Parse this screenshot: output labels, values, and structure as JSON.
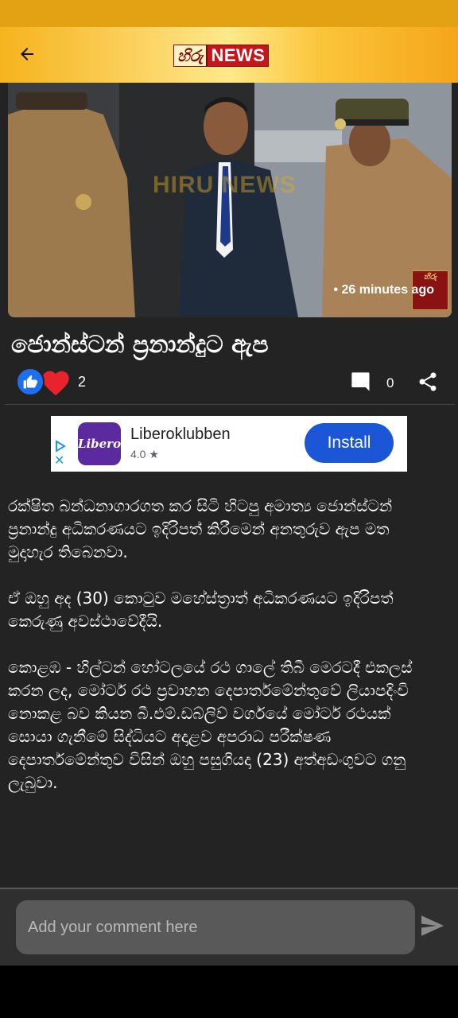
{
  "header": {
    "logo_hiru": "හිරු",
    "logo_news": "NEWS",
    "back_icon": "arrow-left-icon"
  },
  "hero": {
    "watermark": "HIRU NEWS",
    "timestamp": "• 26 minutes ago",
    "logo_text": "හිරු"
  },
  "article": {
    "title": "ජොන්ස්ටන් ප්‍රනාන්දුට ඇප",
    "reaction_count": "2",
    "comment_count": "0",
    "paragraphs": [
      "රක්ෂිත බන්ධනාගාරගත කර සිටි හිටපු අමාත්‍ය ජොන්ස්ටන් ප්‍රනාන්දු අධිකරණයට ඉදිරිපත් කිරීමෙන් අනතුරුව ඇප මත මුදාහැර තිබෙනවා.",
      "ඒ ඔහු අද (30) කොටුව මහේස්ත්‍රාත් අධිකරණයට ඉදිරිපත් කෙරුණු අවස්ථාවේදීයි.",
      "කොළඹ - හිල්ටන් හෝටලයේ රථ ගාලේ තිබී මෙරටදී එකලස් කරන ලද, මෝටර් රථ ප්‍රවාහන දෙපාර්තමේන්තුවේ ලියාපදිංචි නොකළ බව කියන බී.එම්.ඩබ්ලිව් වර්ගයේ මෝටර් රථයක් සොයා ගැනීමේ සිද්ධියට අදාළව අපරාධ පරීක්ෂණ දෙපාර්තමේන්තුව විසින් ඔහු පසුගියදා (23) අත්අඩංගුවට ගනු ලැබුවා."
    ]
  },
  "ad": {
    "app_icon_text": "Libero",
    "app_name": "Liberoklubben",
    "rating": "4.0 ★",
    "install_label": "Install",
    "close_symbol": "✕"
  },
  "comment_bar": {
    "placeholder": "Add your comment here"
  },
  "colors": {
    "header_gold": "#f6b31d",
    "status_bar": "#e3a214",
    "background": "#232323",
    "like_blue": "#1e6ff0",
    "heart_red": "#e8232b",
    "install_blue": "#1a56d6"
  }
}
